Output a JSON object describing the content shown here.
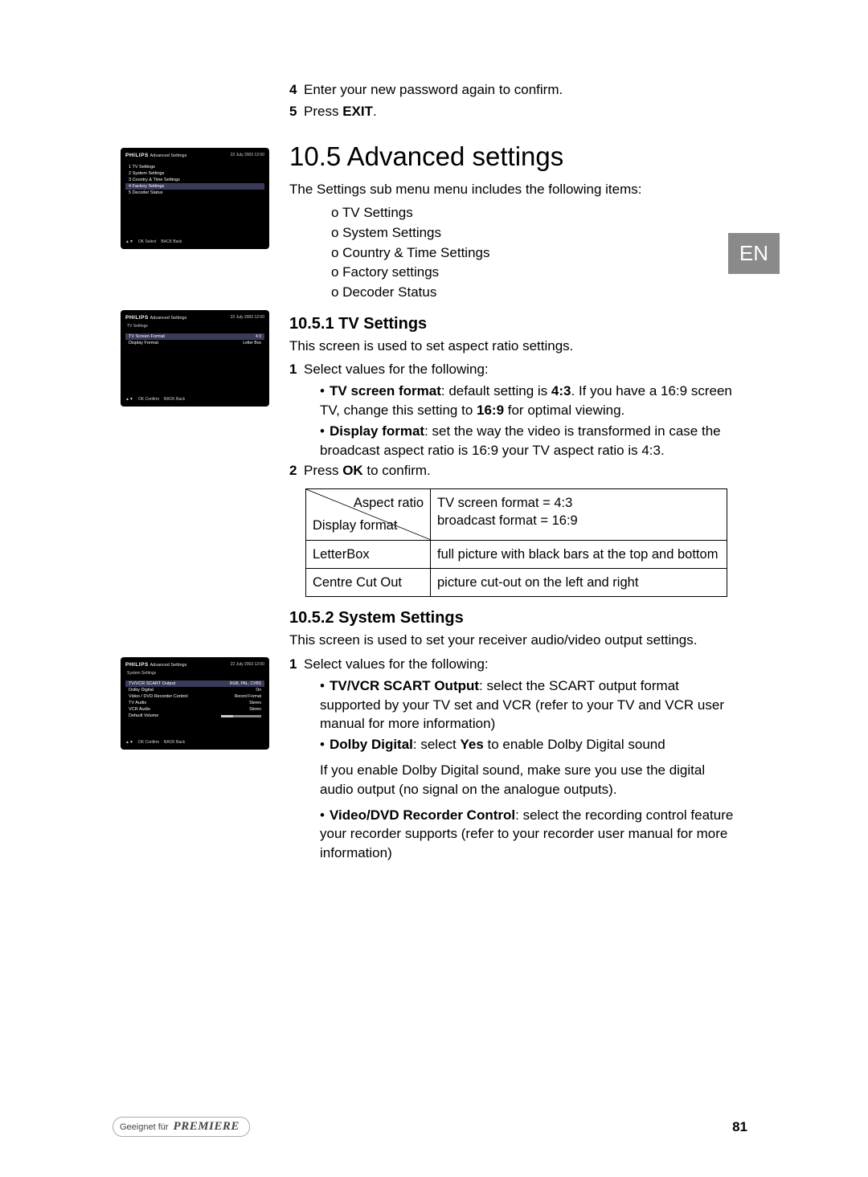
{
  "lang_tab": "EN",
  "top_steps": [
    {
      "num": "4",
      "text": "Enter your new password again to confirm."
    },
    {
      "num": "5",
      "text_prefix": "Press ",
      "bold": "EXIT",
      "text_suffix": "."
    }
  ],
  "heading": "10.5 Advanced settings",
  "intro": "The Settings sub menu menu includes the following items:",
  "menu_items": [
    "o TV Settings",
    "o System Settings",
    "o Country & Time Settings",
    "o Factory settings",
    "o Decoder Status"
  ],
  "section1": {
    "title": "10.5.1 TV Settings",
    "intro": "This screen is used to set aspect ratio settings.",
    "step1_num": "1",
    "step1_text": "Select values for the following:",
    "bullets": [
      {
        "bold": "TV screen format",
        "rest": ": default setting is ",
        "b2": "4:3",
        "rest2": ". If you have a 16:9 screen TV, change this setting to ",
        "b3": "16:9",
        "rest3": " for optimal viewing."
      },
      {
        "bold": "Display format",
        "rest": ": set the way the video is transformed in case the broadcast aspect ratio is 16:9 your TV aspect ratio is 4:3."
      }
    ],
    "step2_num": "2",
    "step2_prefix": "Press ",
    "step2_bold": "OK",
    "step2_suffix": " to confirm.",
    "table": {
      "diag_top": "Aspect ratio",
      "diag_bot": "Display format",
      "header_right": "TV screen format = 4:3\nbroadcast format = 16:9",
      "rows": [
        {
          "l": "LetterBox",
          "r": "full picture with black bars at the top and bottom"
        },
        {
          "l": "Centre Cut Out",
          "r": "picture cut-out on the left and right"
        }
      ]
    }
  },
  "section2": {
    "title": "10.5.2 System Settings",
    "intro": "This screen is used to set your receiver audio/video output settings.",
    "step1_num": "1",
    "step1_text": "Select values for the following:",
    "bullets": [
      {
        "bold": "TV/VCR SCART Output",
        "rest": ": select the SCART output format supported by your TV set and VCR (refer to your TV and VCR user manual for more information)"
      },
      {
        "bold": "Dolby Digital",
        "rest": ": select ",
        "b2": "Yes",
        "rest2": " to enable Dolby Digital sound"
      }
    ],
    "note": "If you enable Dolby Digital sound, make sure you use the digital audio output (no signal on the analogue outputs).",
    "bullet3": {
      "bold": "Video/DVD Recorder Control",
      "rest": ": select the recording control feature your recorder supports (refer to your recorder user manual for more information)"
    }
  },
  "screenshots": {
    "s1": {
      "brand": "PHILIPS",
      "title": "Advanced Settings",
      "time": "22 July 2003   12:00",
      "rows": [
        "1   TV Settings",
        "2   System Settings",
        "3   Country & Time Settings",
        "4   Factory Settings",
        "5   Decoder Status"
      ],
      "sel": 3,
      "footer": [
        "▲▼",
        "OK   Select",
        "BACK   Back"
      ]
    },
    "s2": {
      "brand": "PHILIPS",
      "title": "Advanced Settings",
      "time": "22 July 2003   12:00",
      "sub": "TV Settings",
      "rows": [
        {
          "l": "TV Screen Format",
          "v": "4:3",
          "sel": true
        },
        {
          "l": "Display Format",
          "v": "Letter Box"
        }
      ],
      "footer": [
        "▲▼",
        "OK   Confirm",
        "BACK   Back"
      ]
    },
    "s3": {
      "brand": "PHILIPS",
      "title": "Advanced Settings",
      "time": "22 July 2003   12:00",
      "sub": "System Settings",
      "rows": [
        {
          "l": "TV/VCR SCART Output",
          "v": "RGB, PAL, CVBS",
          "sel": true
        },
        {
          "l": "Dolby Digital",
          "v": "On"
        },
        {
          "l": "Video / DVD Recorder Control",
          "v": "Record Format"
        },
        {
          "l": "TV Audio",
          "v": "Stereo"
        },
        {
          "l": "VCR Audio",
          "v": "Stereo"
        },
        {
          "l": "Default Volume",
          "v": "bar"
        }
      ],
      "footer": [
        "▲▼",
        "OK   Confirm",
        "BACK   Back"
      ]
    }
  },
  "footer": {
    "left_prefix": "Geeignet für",
    "left_brand": "PREMIERE",
    "page_num": "81"
  }
}
